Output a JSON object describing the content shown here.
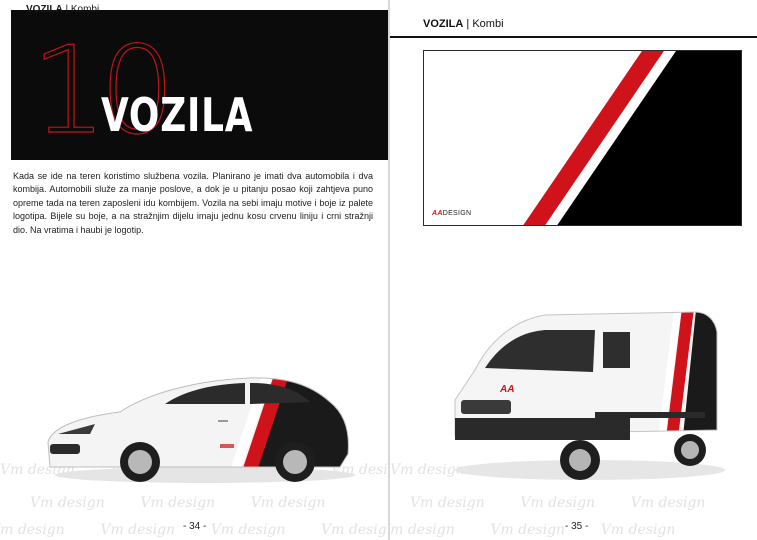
{
  "left_page": {
    "header_bold": "VOZILA",
    "header_sep": "|",
    "header_section": "Kombi",
    "chapter_number": "10",
    "chapter_title": "VOZILA",
    "paragraph": "Kada se ide na teren koristimo službena vozila. Planirano je imati dva automobila i dva kombija. Automobili služe za manje poslove, a dok je u pitanju posao koji zahtjeva puno opreme tada na teren zaposleni idu kombijem. Vozila na sebi imaju motive i boje iz palete logotipa. Bijele su boje, a na stražnjim dijelu imaju jednu kosu crvenu liniju i crni stražnji dio. Na vratima i haubi je logotip.",
    "page_number": "- 34 -",
    "watermark": "Vm design"
  },
  "right_page": {
    "header_bold": "VOZILA",
    "header_sep": "|",
    "header_section": "Kombi",
    "box_logo_mark": "AA",
    "box_logo_text": "DESIGN",
    "page_number": "- 35 -",
    "watermark": "Vm design"
  },
  "colors": {
    "brand_red": "#d0121b",
    "black": "#000000",
    "white": "#ffffff"
  }
}
